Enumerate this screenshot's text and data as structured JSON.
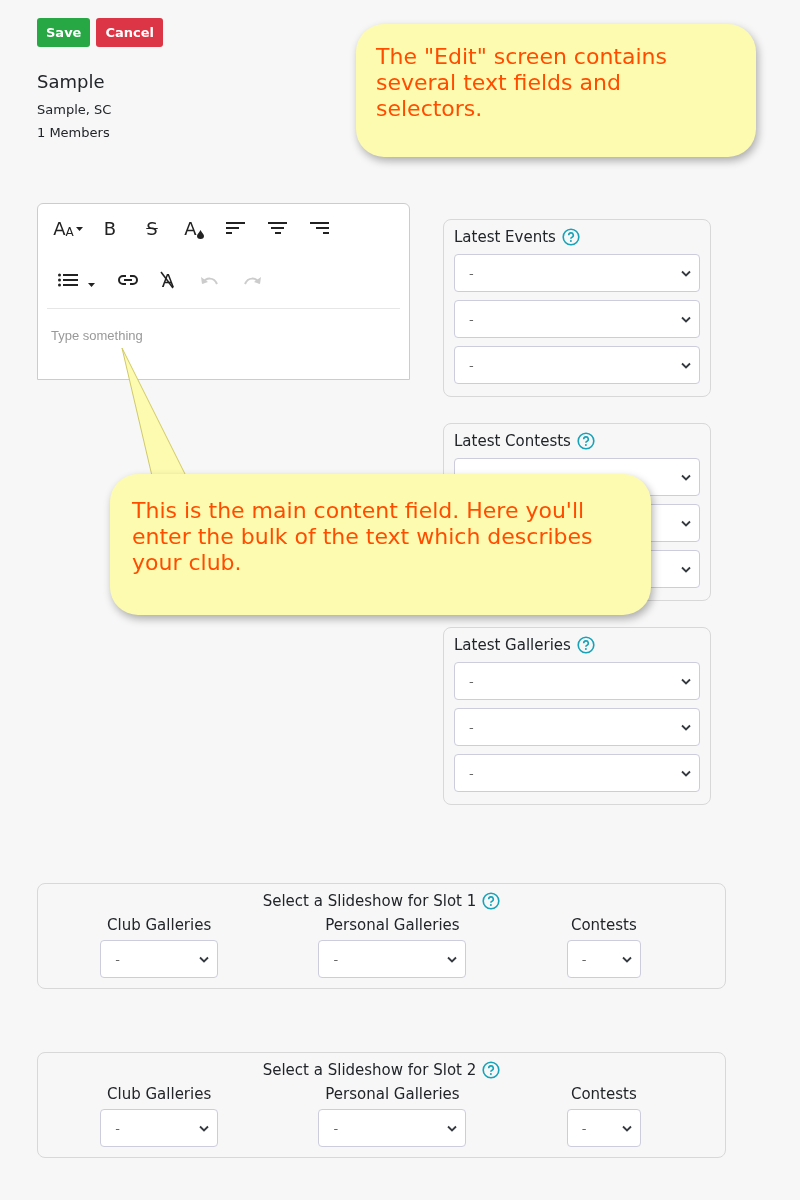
{
  "actions": [
    {
      "label": "Save",
      "kind": "primary"
    },
    {
      "label": "Cancel",
      "kind": "danger"
    }
  ],
  "club": {
    "name": "Sample",
    "location": "Sample, SC",
    "members": "1 Members"
  },
  "editor": {
    "toolbar": [
      {
        "kind": "font-size",
        "label": "A$_{A}$",
        "disabled": false
      },
      {
        "kind": "bold",
        "label": "B",
        "disabled": false
      },
      {
        "kind": "strike",
        "label": "S",
        "disabled": false
      },
      {
        "kind": "color",
        "label": "A",
        "disabled": false
      },
      {
        "kind": "align-left",
        "disabled": false
      },
      {
        "kind": "align-center",
        "disabled": false
      },
      {
        "kind": "align-right",
        "disabled": false
      },
      {
        "kind": "list",
        "disabled": false
      },
      {
        "kind": "link",
        "disabled": false
      },
      {
        "kind": "clear",
        "label": "A",
        "disabled": false
      },
      {
        "kind": "undo",
        "disabled": true
      },
      {
        "kind": "redo",
        "disabled": true
      }
    ],
    "placeholder": "Type something"
  },
  "panels": [
    {
      "title": "Latest Events",
      "selects": [
        {
          "kind": "dropdown",
          "value": "-"
        },
        {
          "kind": "dropdown",
          "value": "-"
        },
        {
          "kind": "dropdown",
          "value": "-"
        }
      ]
    },
    {
      "title": "Latest Contests",
      "selects": [
        {
          "kind": "dropdown"
        },
        {
          "kind": "dropdown"
        },
        {
          "kind": "dropdown"
        }
      ]
    },
    {
      "title": "Latest Galleries",
      "selects": [
        {
          "kind": "dropdown",
          "value": "-"
        },
        {
          "kind": "dropdown",
          "value": "-"
        },
        {
          "kind": "dropdown",
          "value": "-"
        }
      ]
    }
  ],
  "slots": [
    {
      "title": "Select a Slideshow for Slot 1",
      "columns": [
        {
          "label": "Club Galleries",
          "value": "-"
        },
        {
          "label": "Personal Galleries",
          "value": "-"
        },
        {
          "label": "Contests",
          "value": "-"
        }
      ]
    },
    {
      "title": "Select a Slideshow for Slot 2",
      "columns": [
        {
          "label": "Club Galleries",
          "value": "-"
        },
        {
          "label": "Personal Galleries",
          "value": "-"
        },
        {
          "label": "Contests",
          "value": "-"
        }
      ]
    }
  ],
  "callouts": [
    {
      "text": "The \"Edit\" screen contains several text fields and selectors.",
      "kind": "plain"
    },
    {
      "text": "This is the main content field. Here you'll enter the bulk of the text which describes your club.",
      "kind": "pointer"
    }
  ]
}
